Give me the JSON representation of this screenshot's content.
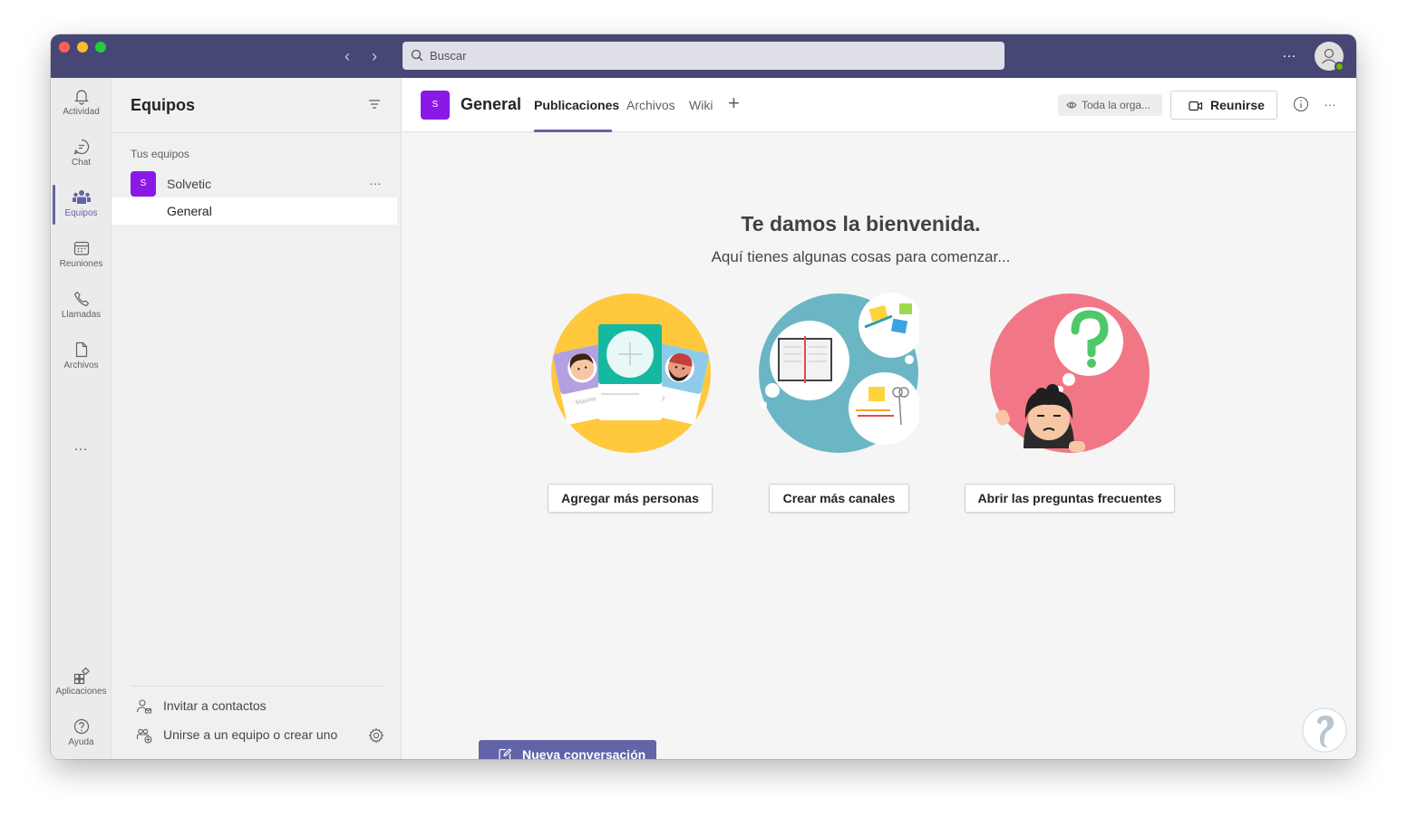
{
  "search": {
    "placeholder": "Buscar"
  },
  "app_bar": [
    {
      "label": "Actividad",
      "icon": "bell-icon"
    },
    {
      "label": "Chat",
      "icon": "chat-icon"
    },
    {
      "label": "Equipos",
      "icon": "teams-icon",
      "active": true
    },
    {
      "label": "Reuniones",
      "icon": "calendar-icon"
    },
    {
      "label": "Llamadas",
      "icon": "phone-icon"
    },
    {
      "label": "Archivos",
      "icon": "file-icon"
    }
  ],
  "app_bar_bottom": [
    {
      "label": "Aplicaciones",
      "icon": "apps-icon"
    },
    {
      "label": "Ayuda",
      "icon": "help-icon"
    }
  ],
  "teams_panel": {
    "title": "Equipos",
    "section_label": "Tus equipos",
    "team": {
      "initial": "S",
      "name": "Solvetic"
    },
    "channel": "General",
    "invite_label": "Invitar a contactos",
    "join_label": "Unirse a un equipo o crear uno"
  },
  "header": {
    "initial": "S",
    "channel_title": "General",
    "tabs": [
      "Publicaciones",
      "Archivos",
      "Wiki"
    ],
    "active_tab": "Publicaciones",
    "org_label": "Toda la orga...",
    "meet_label": "Reunirse"
  },
  "welcome": {
    "title": "Te damos la bienvenida.",
    "subtitle": "Aquí tienes algunas cosas para comenzar...",
    "actions": [
      "Agregar más personas",
      "Crear más canales",
      "Abrir las preguntas frecuentes"
    ],
    "card_names": [
      "Maxine",
      "y"
    ]
  },
  "new_conversation_label": "Nueva conversación",
  "colors": {
    "titlebar": "#464775",
    "accent": "#6264a7",
    "team_avatar": "#8b19e6",
    "illus_people": "#ffc83d",
    "illus_channels": "#6bb6c4",
    "illus_help": "#f27786"
  }
}
